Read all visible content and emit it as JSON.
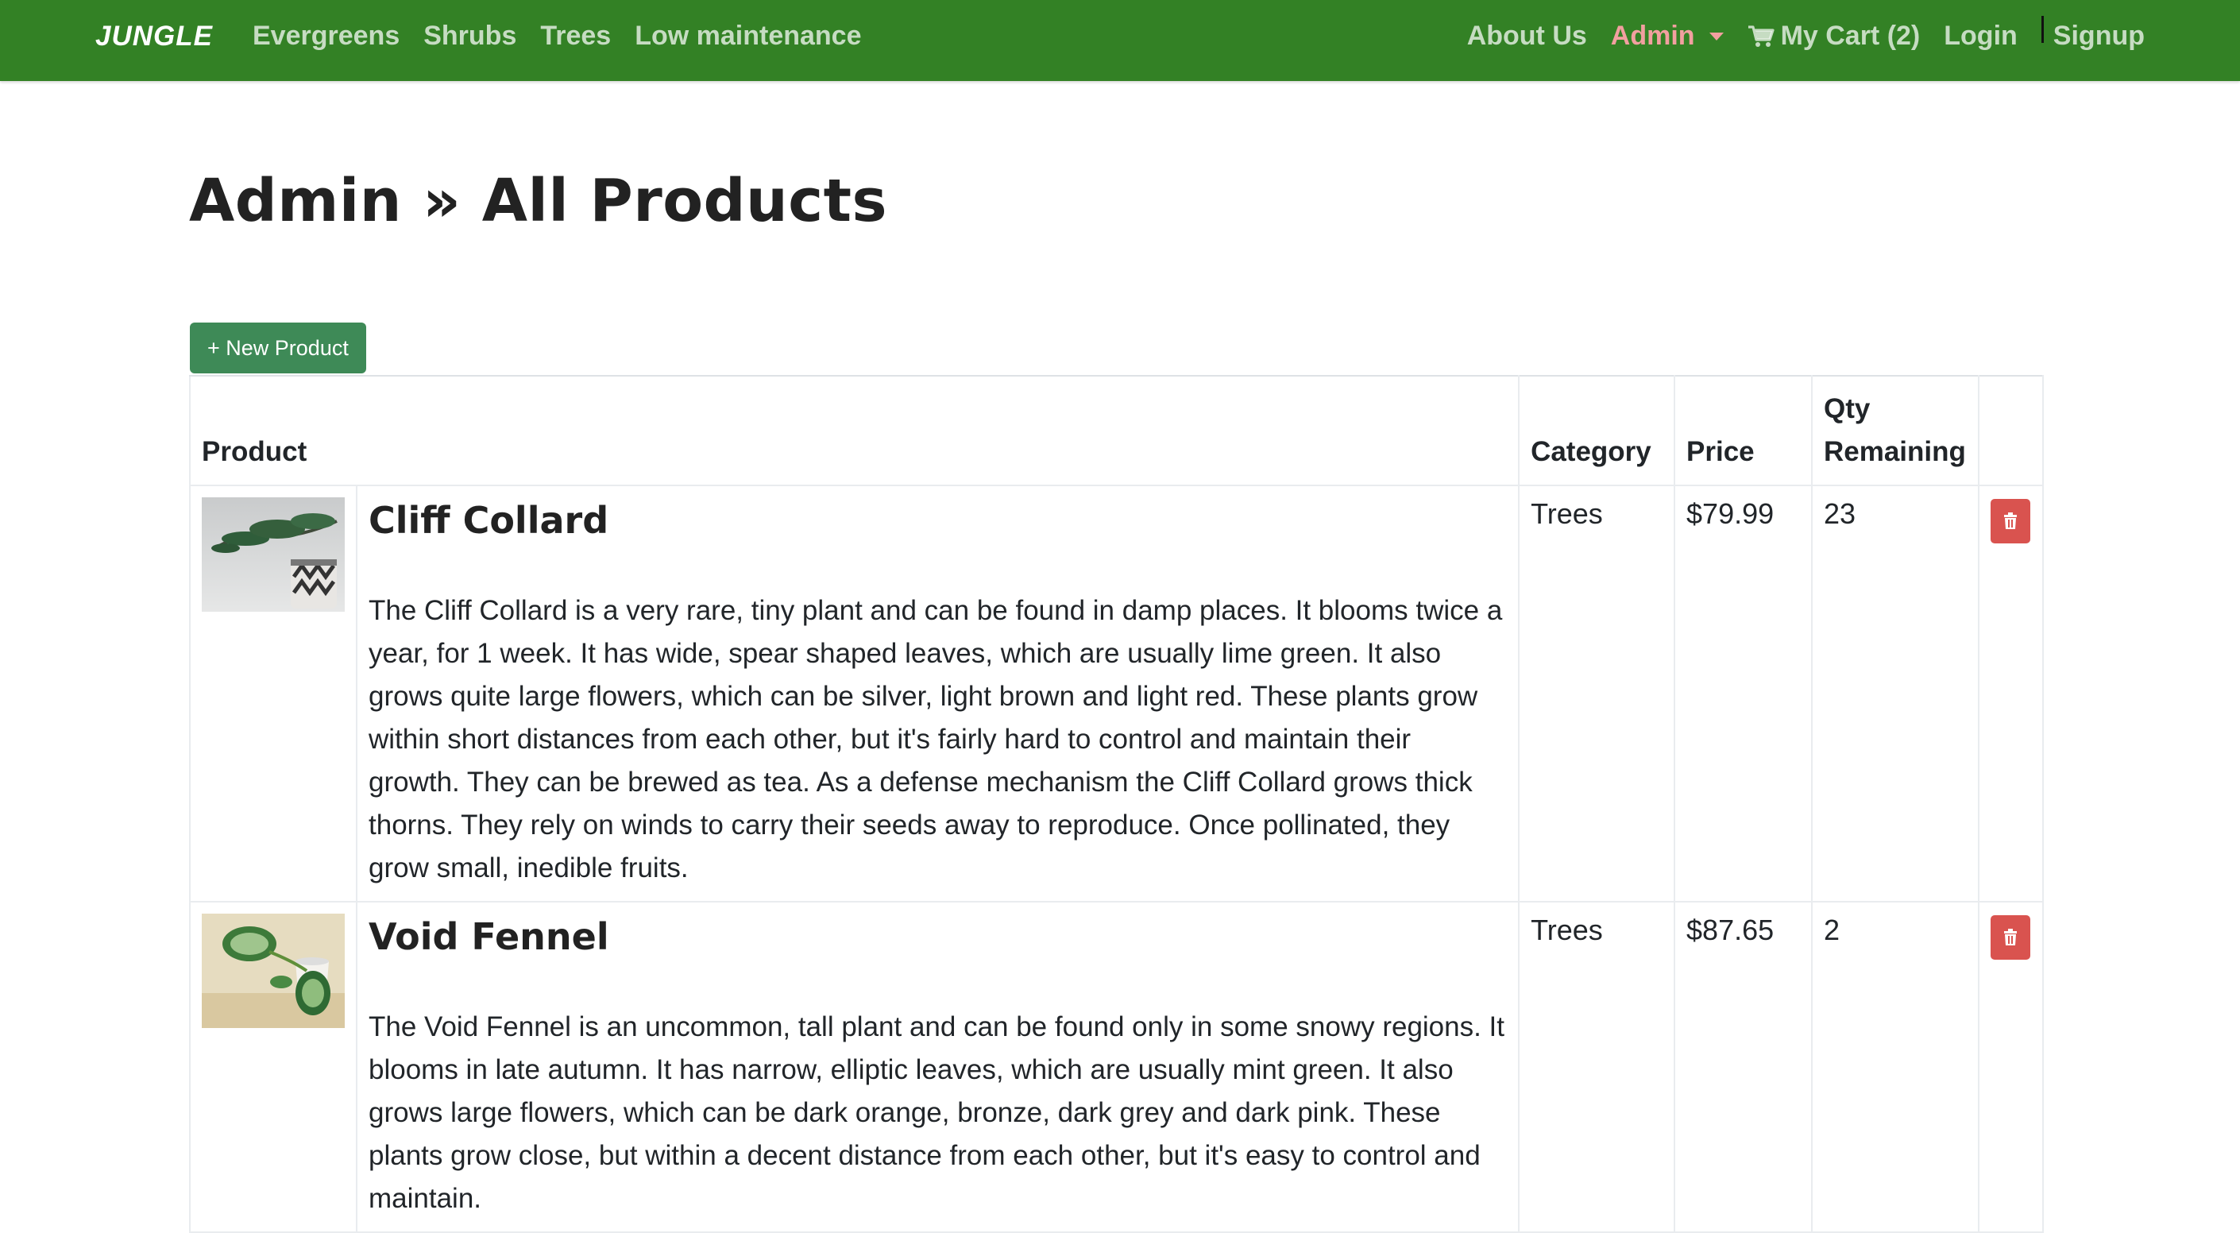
{
  "nav": {
    "brand": "JUNGLE",
    "left_links": [
      "Evergreens",
      "Shrubs",
      "Trees",
      "Low maintenance"
    ],
    "about": "About Us",
    "admin": "Admin",
    "cart": "My Cart (2)",
    "login": "Login",
    "signup": "Signup"
  },
  "page": {
    "title": "Admin » All Products",
    "new_button": "+ New Product"
  },
  "table": {
    "headers": [
      "Product",
      "Category",
      "Price",
      "Qty Remaining"
    ],
    "rows": [
      {
        "name": "Cliff Collard",
        "description": "The Cliff Collard is a very rare, tiny plant and can be found in damp places. It blooms twice a year, for 1 week. It has wide, spear shaped leaves, which are usually lime green. It also grows quite large flowers, which can be silver, light brown and light red. These plants grow within short distances from each other, but it's fairly hard to control and maintain their growth. They can be brewed as tea. As a defense mechanism the Cliff Collard grows thick thorns. They rely on winds to carry their seeds away to reproduce. Once pollinated, they grow small, inedible fruits.",
        "category": "Trees",
        "price": "$79.99",
        "qty": "23",
        "image": "bonsai-pot-image"
      },
      {
        "name": "Void Fennel",
        "description": "The Void Fennel is an uncommon, tall plant and can be found only in some snowy regions. It blooms in late autumn. It has narrow, elliptic leaves, which are usually mint green. It also grows large flowers, which can be dark orange, bronze, dark grey and dark pink. These plants grow close, but within a decent distance from each other, but it's easy to control and maintain.",
        "category": "Trees",
        "price": "$87.65",
        "qty": "2",
        "image": "variegated-leaves-cup-image"
      }
    ]
  },
  "colors": {
    "navbar": "#338125",
    "admin_active": "#f2a0a0",
    "new_button": "#3e8a57",
    "delete_button": "#d9534f"
  },
  "icons": {
    "cart": "shopping-cart-icon",
    "delete": "trash-icon",
    "admin_dropdown": "caret-down-icon"
  }
}
